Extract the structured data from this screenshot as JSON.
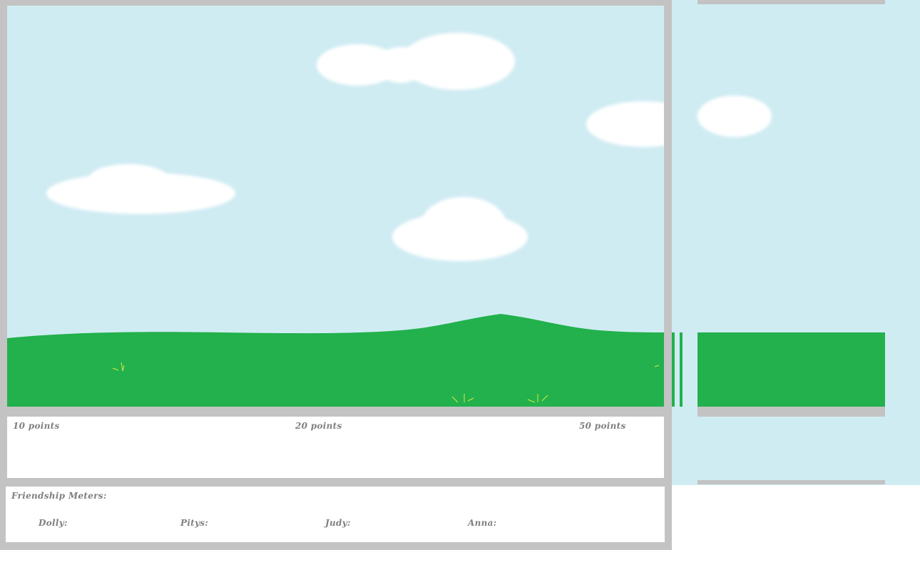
{
  "game": {
    "targets": {
      "ten": "10 points",
      "twenty": "20 points",
      "fifty": "50 points"
    },
    "friendship": {
      "title": "Friendship Meters:",
      "characters": [
        {
          "name": "Dolly:",
          "value": null
        },
        {
          "name": "Pitys:",
          "value": null
        },
        {
          "name": "Judy:",
          "value": null
        },
        {
          "name": "Anna:",
          "value": null
        }
      ]
    }
  },
  "colors": {
    "sky": "#d0ecf3",
    "grass": "#22b14c",
    "frame": "#c3c3c3",
    "text": "#7f7f7f"
  }
}
